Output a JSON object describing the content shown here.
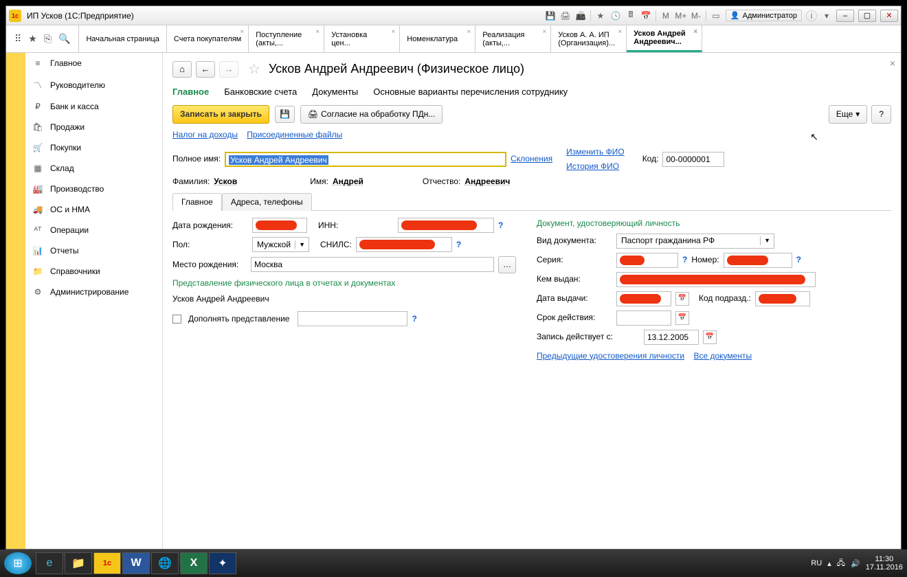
{
  "window": {
    "title": "ИП Усков  (1С:Предприятие)",
    "admin": "Администратор"
  },
  "apptabs": [
    {
      "line1": "Начальная страница",
      "line2": ""
    },
    {
      "line1": "Счета покупателям",
      "line2": ""
    },
    {
      "line1": "Поступление",
      "line2": "(акты,..."
    },
    {
      "line1": "Установка",
      "line2": "цен..."
    },
    {
      "line1": "Номенклатура",
      "line2": ""
    },
    {
      "line1": "Реализация",
      "line2": "(акты,..."
    },
    {
      "line1": "Усков А. А. ИП",
      "line2": "(Организация)..."
    },
    {
      "line1": "Усков Андрей",
      "line2": "Андреевич..."
    }
  ],
  "sidebar": [
    "Главное",
    "Руководителю",
    "Банк и касса",
    "Продажи",
    "Покупки",
    "Склад",
    "Производство",
    "ОС и НМА",
    "Операции",
    "Отчеты",
    "Справочники",
    "Администрирование"
  ],
  "page": {
    "title": "Усков Андрей Андреевич (Физическое лицо)",
    "subtabs": [
      "Главное",
      "Банковские счета",
      "Документы",
      "Основные варианты перечисления сотруднику"
    ],
    "save_close": "Записать и закрыть",
    "consent": "Согласие на обработку ПДн...",
    "more": "Еще",
    "links": {
      "tax": "Налог на доходы",
      "files": "Присоединенные файлы"
    },
    "fullname_label": "Полное имя:",
    "fullname": "Усков Андрей Андреевич",
    "declension": "Склонения",
    "change_fio": "Изменить ФИО",
    "history_fio": "История ФИО",
    "code_label": "Код:",
    "code": "00-0000001",
    "surname_label": "Фамилия:",
    "surname": "Усков",
    "name_label": "Имя:",
    "name": "Андрей",
    "patr_label": "Отчество:",
    "patr": "Андреевич",
    "tabs2": [
      "Главное",
      "Адреса, телефоны"
    ],
    "dob_label": "Дата рождения:",
    "inn_label": "ИНН:",
    "sex_label": "Пол:",
    "sex": "Мужской",
    "snils_label": "СНИЛС:",
    "birthplace_label": "Место рождения:",
    "birthplace": "Москва",
    "repr_title": "Представление физического лица в отчетах и документах",
    "repr_value": "Усков Андрей Андреевич",
    "extend_repr": "Дополнять представление",
    "doc_title": "Документ, удостоверяющий личность",
    "doc_type_label": "Вид документа:",
    "doc_type": "Паспорт гражданина РФ",
    "series_label": "Серия:",
    "number_label": "Номер:",
    "issued_by_label": "Кем выдан:",
    "issue_date_label": "Дата выдачи:",
    "dept_code_label": "Код подразд.:",
    "valid_label": "Срок действия:",
    "effective_label": "Запись действует с:",
    "effective": "13.12.2005",
    "prev_docs": "Предыдущие удостоверения личности",
    "all_docs": "Все документы"
  },
  "tray": {
    "lang": "RU",
    "time": "11:30",
    "date": "17.11.2016"
  }
}
